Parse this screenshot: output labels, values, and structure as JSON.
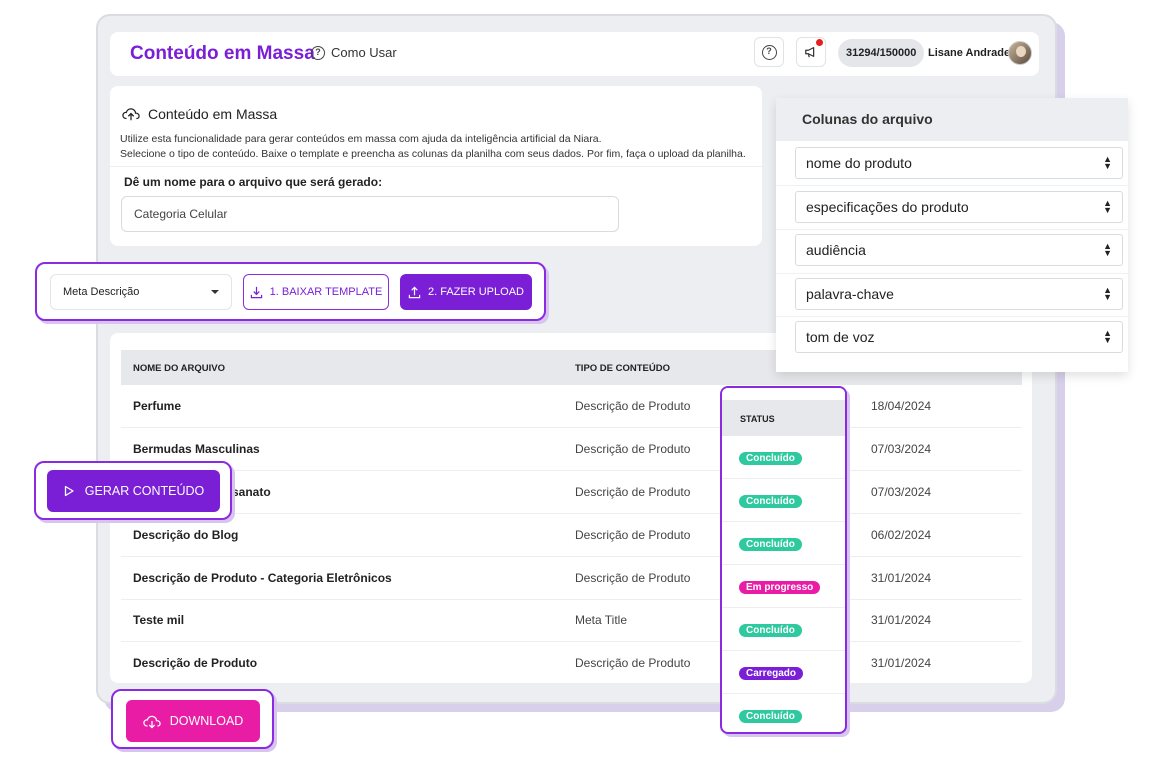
{
  "header": {
    "title": "Conteúdo em Massa",
    "how_to": "Como Usar",
    "credits": "31294/150000",
    "user_name": "Lisane Andrade"
  },
  "info": {
    "title": "Conteúdo em Massa",
    "desc_line1": "Utilize esta funcionalidade para gerar conteúdos em massa com ajuda da inteligência artificial da Niara.",
    "desc_line2": "Selecione o tipo de conteúdo. Baixe o template e preencha as colunas da planilha com seus dados. Por fim, faça o upload da planilha.",
    "name_label": "Dê um nome para o arquivo que será gerado:",
    "name_value": "Categoria Celular"
  },
  "actions": {
    "content_type": "Meta Descrição",
    "download_template": "1. BAIXAR TEMPLATE",
    "upload": "2. FAZER UPLOAD",
    "generate": "GERAR CONTEÚDO",
    "download": "DOWNLOAD"
  },
  "table": {
    "headers": {
      "name": "NOME DO ARQUIVO",
      "type": "TIPO DE CONTEÚDO",
      "status": "STATUS"
    },
    "rows": [
      {
        "name": "Perfume",
        "type": "Descrição de Produto",
        "date": "18/04/2024"
      },
      {
        "name": "Bermudas Masculinas",
        "type": "Descrição de Produto",
        "date": "07/03/2024"
      },
      {
        "name": "sanato",
        "type": "Descrição de Produto",
        "date": "07/03/2024"
      },
      {
        "name": "Descrição do Blog",
        "type": "Descrição de Produto",
        "date": "06/02/2024"
      },
      {
        "name": "Descrição de Produto - Categoria Eletrônicos",
        "type": "Descrição de Produto",
        "date": "31/01/2024"
      },
      {
        "name": "Teste mil",
        "type": "Meta Title",
        "date": "31/01/2024"
      },
      {
        "name": "Descrição de Produto",
        "type": "Descrição de Produto",
        "date": "31/01/2024"
      }
    ],
    "statuses": [
      "Concluído",
      "Concluído",
      "Concluído",
      "Em progresso",
      "Concluído",
      "Carregado",
      "Concluído"
    ]
  },
  "columns_panel": {
    "title": "Colunas do arquivo",
    "options": [
      "nome do produto",
      "especificações do produto",
      "audiência",
      "palavra-chave",
      "tom de voz"
    ]
  },
  "colors": {
    "primary": "#7a1fd6",
    "download": "#e91ca5",
    "status_done": "#2ec99e",
    "status_progress": "#e91ca5",
    "status_loaded": "#7a1fd6"
  },
  "icons": {
    "help": "question-circle-icon",
    "notifications": "megaphone-icon",
    "upload_cloud": "cloud-upload-icon",
    "template": "download-icon",
    "upload": "upload-icon",
    "generate": "play-icon",
    "download": "cloud-download-icon"
  }
}
